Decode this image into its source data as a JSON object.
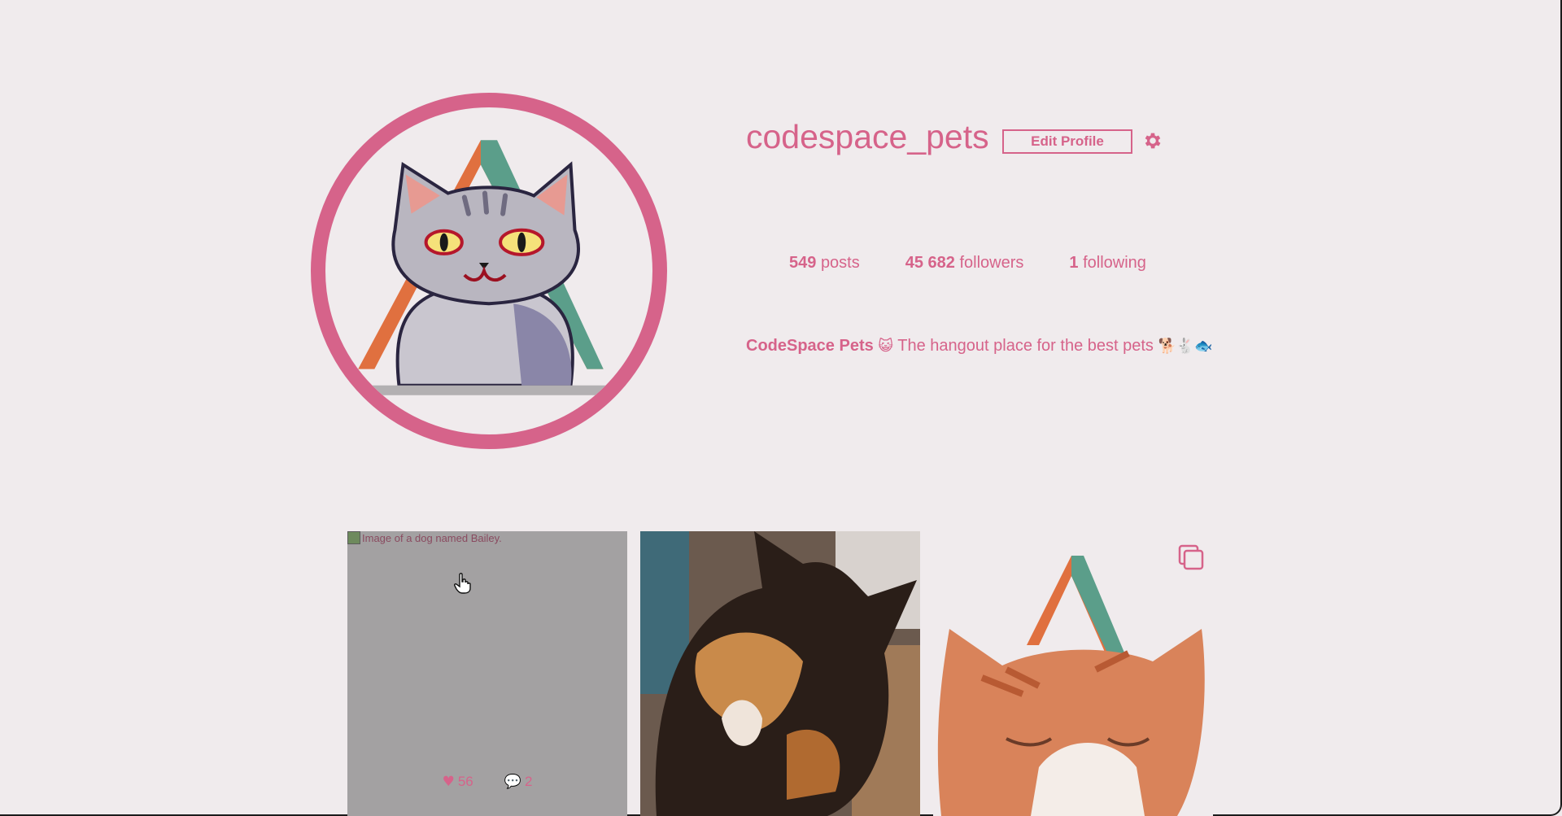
{
  "profile": {
    "username": "codespace_pets",
    "edit_profile_label": "Edit Profile",
    "stats": [
      {
        "count": "549",
        "label": "posts"
      },
      {
        "count": "45 682",
        "label": "followers"
      },
      {
        "count": "1",
        "label": "following"
      }
    ],
    "bio_name": "CodeSpace Pets",
    "bio_text": " The hangout place for the best pets ",
    "bio_emoji_cat": "😺",
    "bio_emoji_end": "🐕🐇🐟"
  },
  "posts": [
    {
      "alt_text": "Image of a dog named Bailey.",
      "likes": "56",
      "comments": "2"
    },
    {
      "alt_text": ""
    },
    {
      "alt_text": ""
    }
  ],
  "colors": {
    "accent": "#d6638a",
    "background": "#f0ebed",
    "triangle_left": "#e0703f",
    "triangle_right": "#5b9e8a"
  },
  "icons": [
    "gear-icon",
    "heart-icon",
    "comment-icon",
    "multiple-images-icon",
    "hand-cursor-icon"
  ]
}
